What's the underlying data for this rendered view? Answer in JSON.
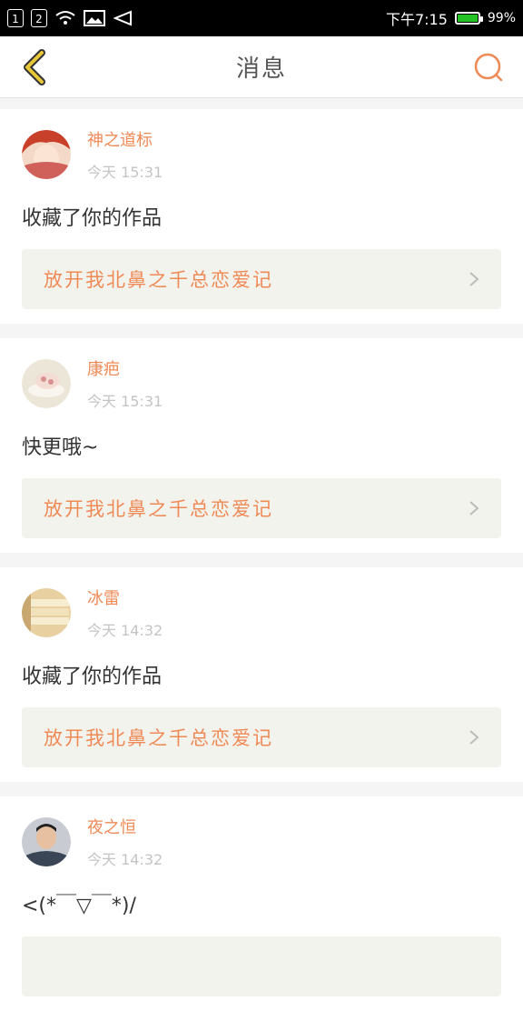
{
  "statusbar": {
    "sim1": "1",
    "sim2": "2",
    "time": "下午7:15",
    "battery": "99%",
    "battery_level": 0.99
  },
  "header": {
    "title": "消息"
  },
  "colors": {
    "accent": "#ef8a56",
    "back_icon": "#e8c838"
  },
  "messages": [
    {
      "user": "神之道标",
      "time": "今天 15:31",
      "text": "收藏了你的作品",
      "work": "放开我北鼻之千总恋爱记"
    },
    {
      "user": "康疤",
      "time": "今天 15:31",
      "text": "快更哦~",
      "work": "放开我北鼻之千总恋爱记"
    },
    {
      "user": "冰雷",
      "time": "今天 14:32",
      "text": "收藏了你的作品",
      "work": "放开我北鼻之千总恋爱记"
    },
    {
      "user": "夜之恒",
      "time": "今天 14:32",
      "text": "<(*￣▽￣*)/",
      "work": ""
    }
  ]
}
